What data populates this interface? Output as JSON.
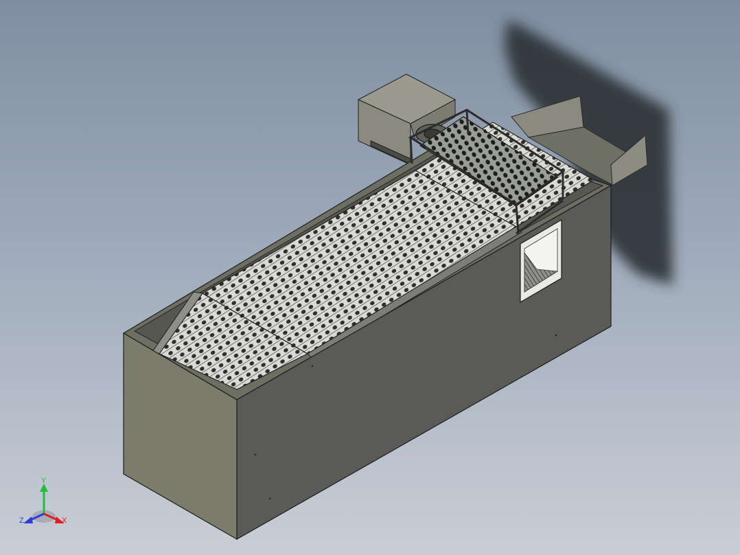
{
  "viewport": {
    "background_top": "#7f8ea1",
    "background_bottom": "#c9ced6"
  },
  "model": {
    "body_front_color": "#5a5a59",
    "body_end_color": "#7b7c6c",
    "top_color": "#6e6f63",
    "conveyor_plate_color": "#d4d6cf",
    "conveyor_hole_color": "#2c2e2f",
    "motor_color": "#8a8b7e",
    "shadow_color": "#2e3337",
    "hopper_color": "#7a7b6e"
  },
  "triad": {
    "x_label": "X",
    "y_label": "Y",
    "z_label": "Z",
    "x_color": "#e02020",
    "y_color": "#1fbf3a",
    "z_color": "#2b3fd8"
  }
}
